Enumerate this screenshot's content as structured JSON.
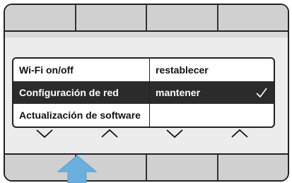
{
  "menu": {
    "left_items": [
      {
        "label": "Wi-Fi on/off",
        "selected": false
      },
      {
        "label": "Configuración de red",
        "selected": true
      },
      {
        "label": "Actualización de software",
        "selected": false
      }
    ],
    "right_items": [
      {
        "label": "restablecer",
        "selected": false
      },
      {
        "label": "mantener",
        "selected": true,
        "checked": true
      },
      {
        "label": "",
        "selected": false
      }
    ]
  },
  "nav_arrows": [
    "chevron-down-icon",
    "chevron-up-icon",
    "chevron-down-icon",
    "chevron-up-icon"
  ],
  "highlight_arrow": {
    "icon": "arrow-up-icon",
    "color": "#6ab0de",
    "points_to_softkey": 1
  },
  "colors": {
    "selected_row": "#2b2b2b",
    "softkey": "#d0d0d0",
    "frame": "#222222"
  }
}
